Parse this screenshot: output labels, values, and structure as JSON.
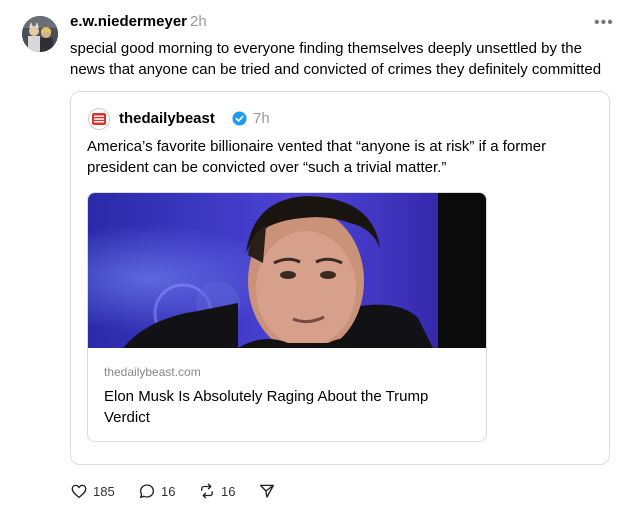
{
  "post": {
    "username": "e.w.niedermeyer",
    "time": "2h",
    "text": "special good morning to everyone finding themselves deeply unsettled by the news that anyone can be tried and convicted of crimes they definitely committed",
    "more_icon": "more-horizontal-icon"
  },
  "quote": {
    "username": "thedailybeast",
    "verified": true,
    "time": "7h",
    "text": "America’s favorite billionaire vented that “anyone is at risk” if a former president can be convicted over “such a trivial matter.”",
    "link": {
      "domain": "thedailybeast.com",
      "title": "Elon Musk Is Absolutely Raging About the Trump Verdict"
    }
  },
  "actions": {
    "likes": "185",
    "replies": "16",
    "reposts": "16"
  },
  "colors": {
    "verified": "#1d9bf0",
    "muted": "#999999",
    "border": "#dcdcdc"
  }
}
